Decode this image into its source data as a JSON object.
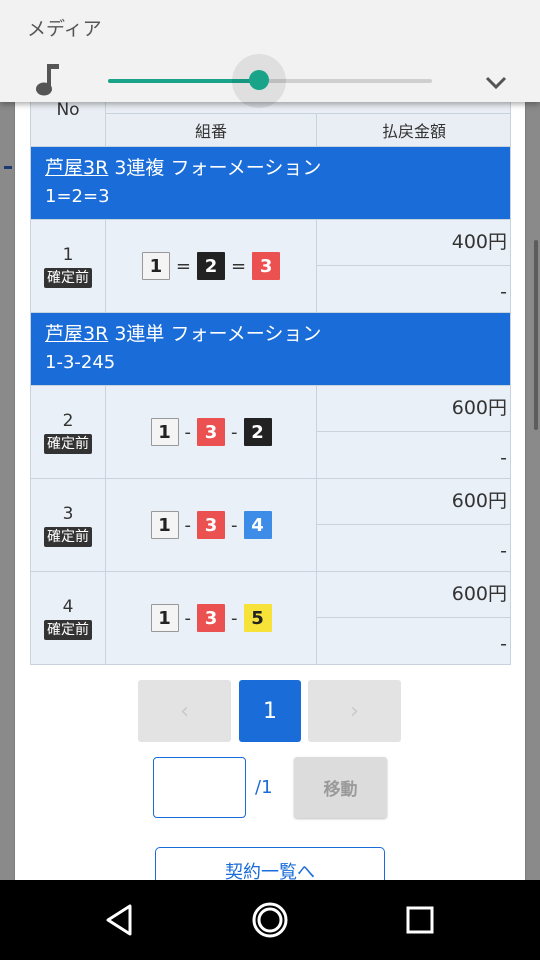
{
  "media": {
    "title": "メディア",
    "volume_level": 0.46,
    "accent": "#19a48a"
  },
  "table": {
    "headers": {
      "no": "No",
      "combo": "組番",
      "payout": "払戻金額"
    },
    "sections": [
      {
        "venue": "芦屋3R",
        "bet_type": "3連複 フォーメーション",
        "formation": "1=2=3",
        "rows": [
          {
            "no": "1",
            "status": "確定前",
            "combo": [
              {
                "n": "1",
                "c": "white"
              },
              {
                "s": "="
              },
              {
                "n": "2",
                "c": "black"
              },
              {
                "s": "="
              },
              {
                "n": "3",
                "c": "red"
              }
            ],
            "amount": "400円",
            "payout": "-"
          }
        ]
      },
      {
        "venue": "芦屋3R",
        "bet_type": "3連単 フォーメーション",
        "formation": "1-3-245",
        "rows": [
          {
            "no": "2",
            "status": "確定前",
            "combo": [
              {
                "n": "1",
                "c": "white"
              },
              {
                "s": "-"
              },
              {
                "n": "3",
                "c": "red"
              },
              {
                "s": "-"
              },
              {
                "n": "2",
                "c": "black"
              }
            ],
            "amount": "600円",
            "payout": "-"
          },
          {
            "no": "3",
            "status": "確定前",
            "combo": [
              {
                "n": "1",
                "c": "white"
              },
              {
                "s": "-"
              },
              {
                "n": "3",
                "c": "red"
              },
              {
                "s": "-"
              },
              {
                "n": "4",
                "c": "blue"
              }
            ],
            "amount": "600円",
            "payout": "-"
          },
          {
            "no": "4",
            "status": "確定前",
            "combo": [
              {
                "n": "1",
                "c": "white"
              },
              {
                "s": "-"
              },
              {
                "n": "3",
                "c": "red"
              },
              {
                "s": "-"
              },
              {
                "n": "5",
                "c": "yellow"
              }
            ],
            "amount": "600円",
            "payout": "-"
          }
        ]
      }
    ]
  },
  "pagination": {
    "prev": "‹",
    "current": "1",
    "next": "›",
    "total": "/1",
    "jump_value": "",
    "jump_label": "移動"
  },
  "contract_list_label": "契約一覧へ",
  "navbar": {
    "back": "back-icon",
    "home": "home-icon",
    "recents": "recents-icon"
  }
}
